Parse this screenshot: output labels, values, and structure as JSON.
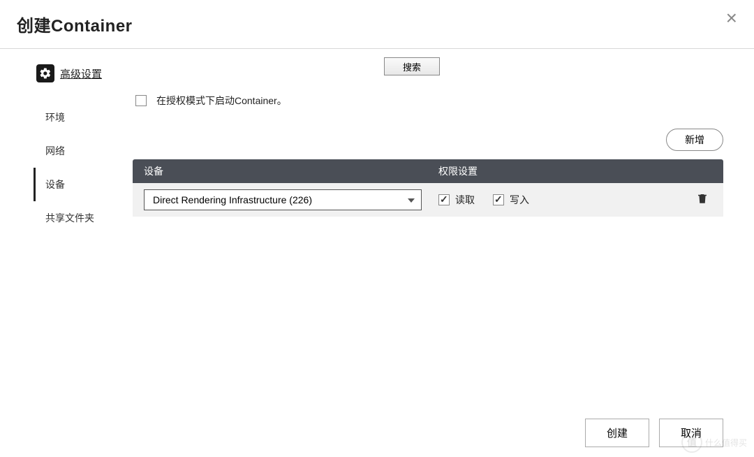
{
  "header": {
    "title": "创建Container"
  },
  "advanced": {
    "link_label": "高级设置"
  },
  "sidebar": {
    "items": [
      {
        "label": "环境",
        "key": "env"
      },
      {
        "label": "网络",
        "key": "network"
      },
      {
        "label": "设备",
        "key": "device",
        "active": true
      },
      {
        "label": "共享文件夹",
        "key": "shared"
      }
    ]
  },
  "toolbar": {
    "search_label": "搜索",
    "add_label": "新增"
  },
  "privileged": {
    "checked": false,
    "label": "在授权模式下启动Container。"
  },
  "table": {
    "headers": {
      "device": "设备",
      "perm": "权限设置"
    },
    "rows": [
      {
        "device_selected": "Direct Rendering Infrastructure (226)",
        "read": {
          "checked": true,
          "label": "读取"
        },
        "write": {
          "checked": true,
          "label": "写入"
        }
      }
    ]
  },
  "footer": {
    "create_label": "创建",
    "cancel_label": "取消"
  },
  "watermark": {
    "text": "什么值得买"
  }
}
